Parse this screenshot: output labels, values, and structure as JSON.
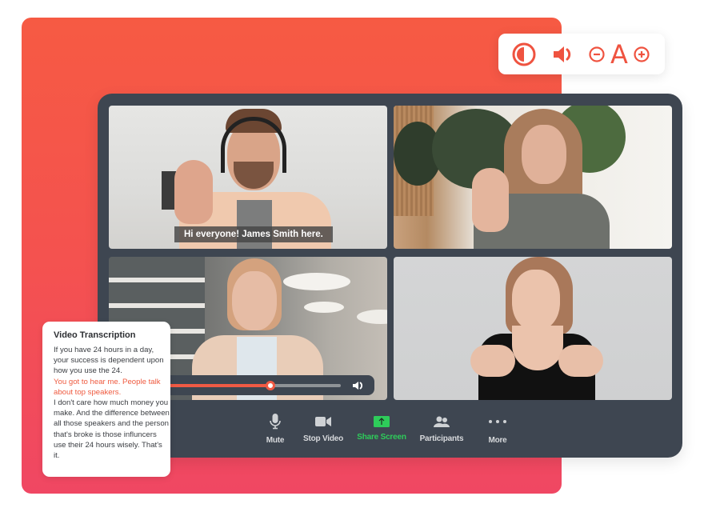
{
  "colors": {
    "accent": "#ef5340",
    "panel_gradient_top": "#f65a43",
    "panel_gradient_bottom": "#f04763",
    "window_bg": "#3e4651",
    "share_green": "#2ecc5a",
    "highlight_text": "#ef5a3f"
  },
  "accessibility_toolbar": {
    "contrast_icon": "contrast-icon",
    "volume_icon": "speaker-icon",
    "decrease_font_icon": "minus-circle-icon",
    "font_label": "A",
    "increase_font_icon": "plus-circle-icon"
  },
  "video_tiles": [
    {
      "participant": "James Smith",
      "caption": "Hi everyone! James Smith here."
    },
    {
      "participant": ""
    },
    {
      "participant": ""
    },
    {
      "participant": ""
    }
  ],
  "player": {
    "progress": 0.68,
    "volume_icon": "speaker-icon"
  },
  "controls": [
    {
      "id": "mute",
      "label": "Mute",
      "icon": "microphone-icon"
    },
    {
      "id": "stop-video",
      "label": "Stop Video",
      "icon": "video-camera-icon"
    },
    {
      "id": "share-screen",
      "label": "Share Screen",
      "icon": "share-screen-icon",
      "active": true
    },
    {
      "id": "participants",
      "label": "Participants",
      "icon": "participants-icon"
    },
    {
      "id": "more",
      "label": "More",
      "icon": "more-dots-icon"
    }
  ],
  "transcript": {
    "title": "Video Transcription",
    "text_before": "If you have 24 hours in a day, your success is dependent upon how you use the 24.",
    "text_highlight": "You got to hear me. People talk about top speakers.",
    "text_after": "I don't care how much money you make. And the difference between all those speakers  and the person that's broke is those influncers use their 24 hours wisely. That's it."
  }
}
